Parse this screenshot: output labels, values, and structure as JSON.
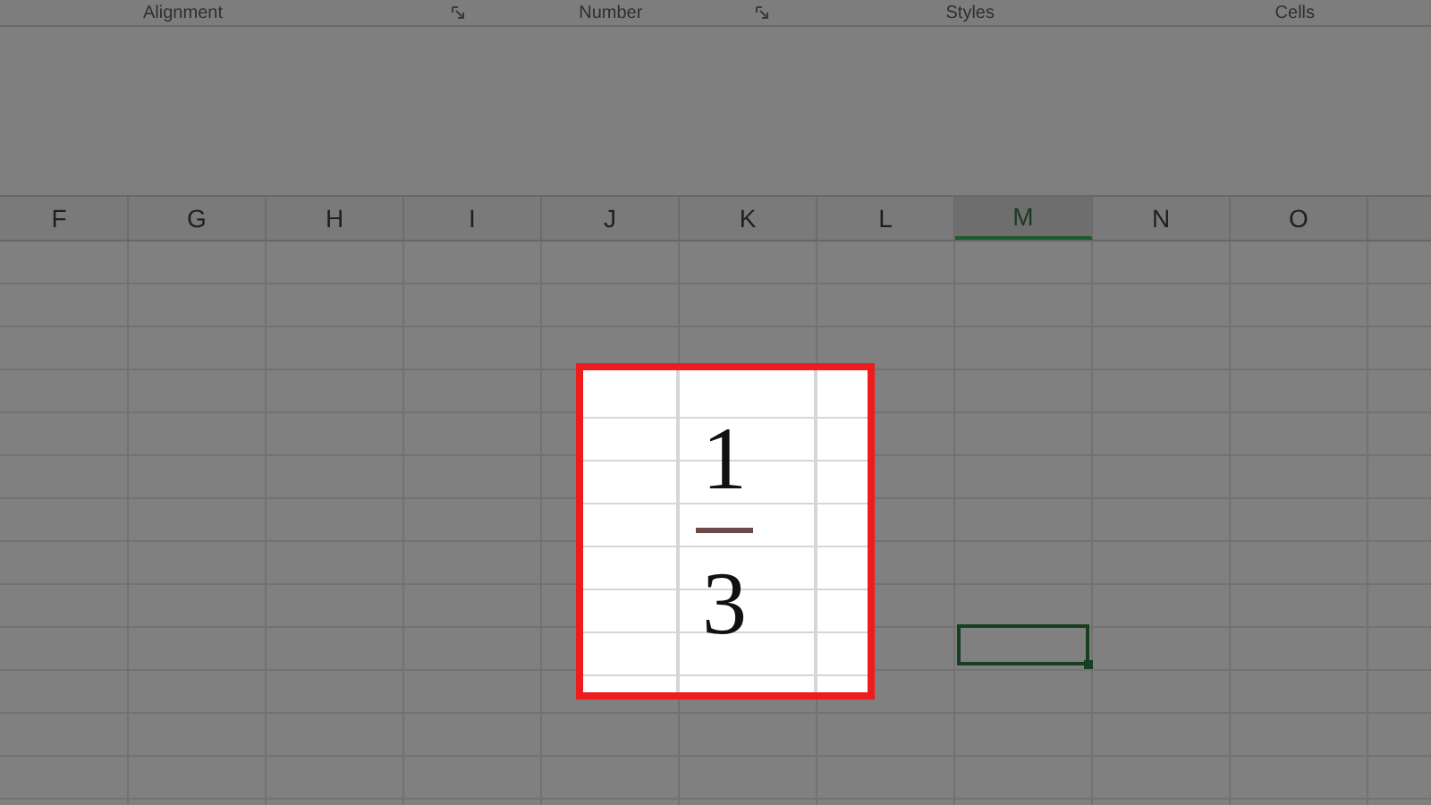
{
  "ribbon_groups": [
    {
      "label": "Alignment",
      "launcher": true
    },
    {
      "label": "Number",
      "launcher": true
    },
    {
      "label": "Styles",
      "launcher": false
    },
    {
      "label": "Cells",
      "launcher": false
    }
  ],
  "columns": [
    {
      "label": "F",
      "selected": false
    },
    {
      "label": "G",
      "selected": false
    },
    {
      "label": "H",
      "selected": false
    },
    {
      "label": "I",
      "selected": false
    },
    {
      "label": "J",
      "selected": false
    },
    {
      "label": "K",
      "selected": false
    },
    {
      "label": "L",
      "selected": false
    },
    {
      "label": "M",
      "selected": true
    },
    {
      "label": "N",
      "selected": false
    },
    {
      "label": "O",
      "selected": false
    }
  ],
  "fraction": {
    "numerator": "1",
    "denominator": "3"
  }
}
